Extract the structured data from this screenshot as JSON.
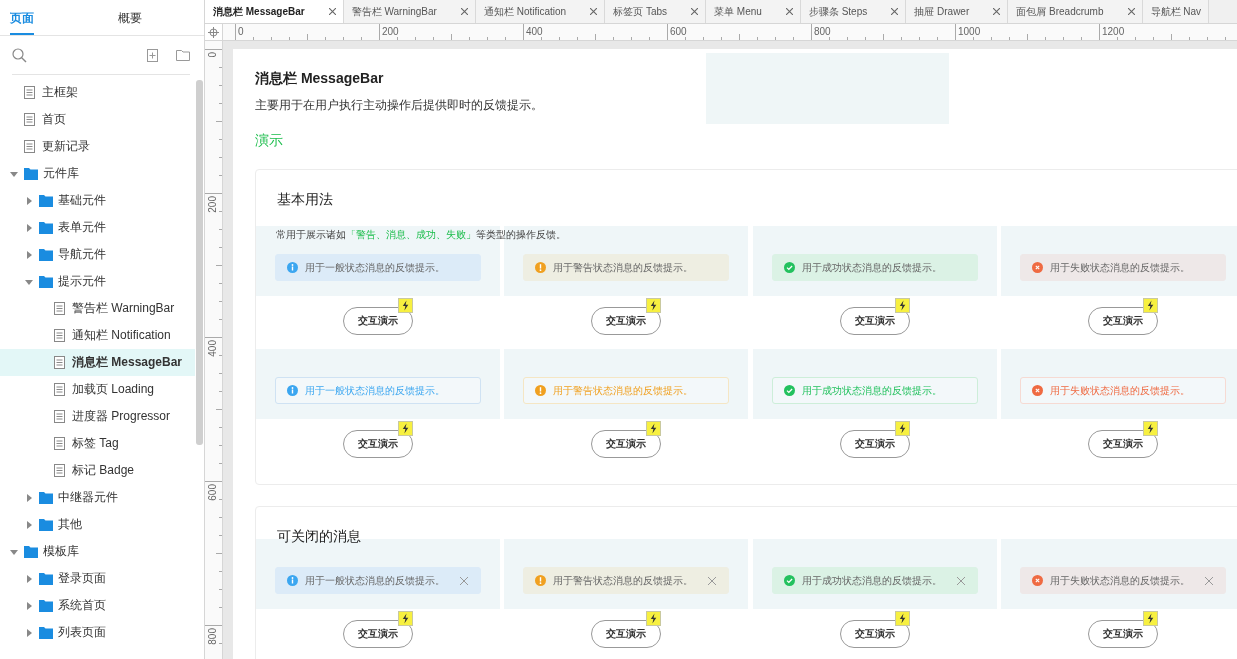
{
  "sidebar": {
    "tabs": [
      {
        "label": "页面",
        "selected": true
      },
      {
        "label": "概要",
        "selected": false
      }
    ],
    "tree": [
      {
        "label": "主框架",
        "kind": "page",
        "selected": false
      },
      {
        "label": "首页",
        "kind": "page",
        "selected": false
      },
      {
        "label": "更新记录",
        "kind": "page",
        "selected": false
      },
      {
        "label": "元件库",
        "kind": "folder",
        "expanded": true,
        "selected": false,
        "children": [
          {
            "label": "基础元件",
            "kind": "folder",
            "expanded": false,
            "selected": false
          },
          {
            "label": "表单元件",
            "kind": "folder",
            "expanded": false,
            "selected": false
          },
          {
            "label": "导航元件",
            "kind": "folder",
            "expanded": false,
            "selected": false
          },
          {
            "label": "提示元件",
            "kind": "folder",
            "expanded": true,
            "selected": false,
            "children": [
              {
                "label": "警告栏 WarningBar",
                "kind": "page",
                "selected": false
              },
              {
                "label": "通知栏 Notification",
                "kind": "page",
                "selected": false
              },
              {
                "label": "消息栏 MessageBar",
                "kind": "page",
                "selected": true
              },
              {
                "label": "加载页 Loading",
                "kind": "page",
                "selected": false
              },
              {
                "label": "进度器 Progressor",
                "kind": "page",
                "selected": false
              },
              {
                "label": "标签 Tag",
                "kind": "page",
                "selected": false
              },
              {
                "label": "标记 Badge",
                "kind": "page",
                "selected": false
              }
            ]
          },
          {
            "label": "中继器元件",
            "kind": "folder",
            "expanded": false,
            "selected": false
          },
          {
            "label": "其他",
            "kind": "folder",
            "expanded": false,
            "selected": false
          }
        ]
      },
      {
        "label": "模板库",
        "kind": "folder",
        "expanded": true,
        "selected": false,
        "children": [
          {
            "label": "登录页面",
            "kind": "folder",
            "expanded": false,
            "selected": false
          },
          {
            "label": "系统首页",
            "kind": "folder",
            "expanded": false,
            "selected": false
          },
          {
            "label": "列表页面",
            "kind": "folder",
            "expanded": false,
            "selected": false
          }
        ]
      }
    ]
  },
  "doc_tabs": [
    {
      "label": "消息栏 MessageBar",
      "selected": true,
      "closable": true
    },
    {
      "label": "警告栏 WarningBar",
      "selected": false,
      "closable": true
    },
    {
      "label": "通知栏 Notification",
      "selected": false,
      "closable": true
    },
    {
      "label": "标签页 Tabs",
      "selected": false,
      "closable": true
    },
    {
      "label": "菜单 Menu",
      "selected": false,
      "closable": true
    },
    {
      "label": "步骤条 Steps",
      "selected": false,
      "closable": true
    },
    {
      "label": "抽屉 Drawer",
      "selected": false,
      "closable": true
    },
    {
      "label": "面包屑 Breadcrumb",
      "selected": false,
      "closable": true
    },
    {
      "label": "导航栏 Nav",
      "selected": false,
      "closable": false
    }
  ],
  "ruler": {
    "x_labels": [
      "0",
      "200",
      "400",
      "600",
      "800",
      "1000",
      "1200"
    ],
    "y_labels": [
      "0",
      "200",
      "400",
      "600",
      "800"
    ]
  },
  "page": {
    "title": "消息栏 MessageBar",
    "description": "主要用于在用户执行主动操作后提供即时的反馈提示。",
    "demo_heading": "演示",
    "sections": [
      {
        "title": "基本用法",
        "description": [
          {
            "text": "常用于展示诸如",
            "highlighted": false
          },
          {
            "text": "「警告、消息、成功、失败」",
            "highlighted": true
          },
          {
            "text": "等类型的操作反馈。",
            "highlighted": false
          }
        ],
        "rows": [
          {
            "kind": "filled",
            "closable": false,
            "items": [
              {
                "kind": "info",
                "text": "用于一般状态消息的反馈提示。",
                "button": "交互演示"
              },
              {
                "kind": "warning",
                "text": "用于警告状态消息的反馈提示。",
                "button": "交互演示"
              },
              {
                "kind": "success",
                "text": "用于成功状态消息的反馈提示。",
                "button": "交互演示"
              },
              {
                "kind": "error",
                "text": "用于失败状态消息的反馈提示。",
                "button": "交互演示"
              }
            ]
          },
          {
            "kind": "outlined",
            "closable": false,
            "items": [
              {
                "kind": "info",
                "text": "用于一般状态消息的反馈提示。",
                "button": "交互演示"
              },
              {
                "kind": "warning",
                "text": "用于警告状态消息的反馈提示。",
                "button": "交互演示"
              },
              {
                "kind": "success",
                "text": "用于成功状态消息的反馈提示。",
                "button": "交互演示"
              },
              {
                "kind": "error",
                "text": "用于失败状态消息的反馈提示。",
                "button": "交互演示"
              }
            ]
          }
        ]
      },
      {
        "title": "可关闭的消息",
        "rows": [
          {
            "kind": "filled",
            "closable": true,
            "items": [
              {
                "kind": "info",
                "text": "用于一般状态消息的反馈提示。",
                "button": "交互演示"
              },
              {
                "kind": "warning",
                "text": "用于警告状态消息的反馈提示。",
                "button": "交互演示"
              },
              {
                "kind": "success",
                "text": "用于成功状态消息的反馈提示。",
                "button": "交互演示"
              },
              {
                "kind": "error",
                "text": "用于失败状态消息的反馈提示。",
                "button": "交互演示"
              }
            ]
          }
        ]
      }
    ]
  }
}
